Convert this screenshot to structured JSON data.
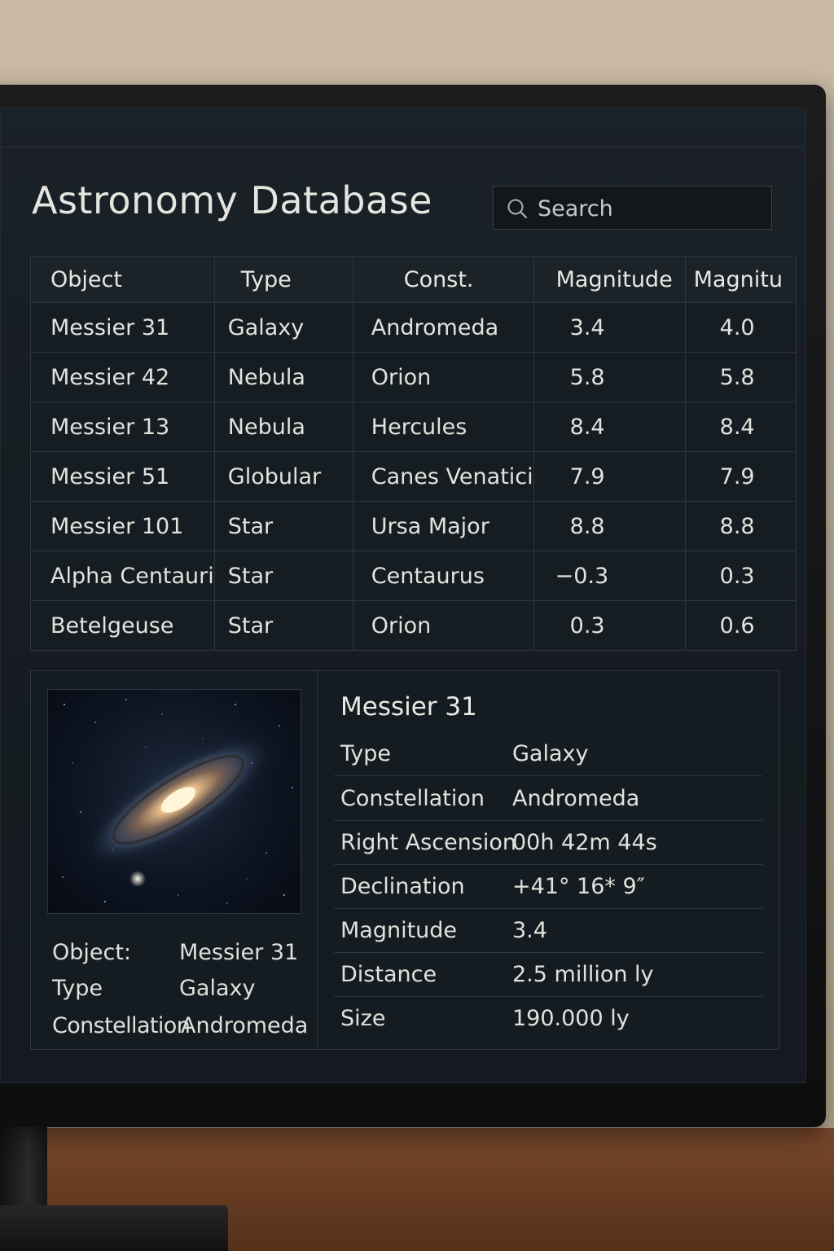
{
  "app": {
    "title": "Astronomy Database"
  },
  "search": {
    "placeholder": "Search"
  },
  "table": {
    "columns": [
      "Object",
      "Type",
      "Const.",
      "Magnitude",
      "Magnitu"
    ],
    "rows": [
      [
        "Messier 31",
        "Galaxy",
        "Andromeda",
        "3.4",
        "4.0"
      ],
      [
        "Messier 42",
        "Nebula",
        "Orion",
        "5.8",
        "5.8"
      ],
      [
        "Messier 13",
        "Nebula",
        "Hercules",
        "8.4",
        "8.4"
      ],
      [
        "Messier 51",
        "Globular",
        "Canes Venatici",
        "7.9",
        "7.9"
      ],
      [
        "Messier 101",
        "Star",
        "Ursa Major",
        "8.8",
        "8.8"
      ],
      [
        "Alpha Centauri",
        "Star",
        "Centaurus",
        "−0.3",
        "0.3"
      ],
      [
        "Betelgeuse",
        "Star",
        "Orion",
        "0.3",
        "0.6"
      ]
    ]
  },
  "preview": {
    "image_icon": "galaxy-image",
    "rows": [
      {
        "label": "Object:",
        "value": "Messier 31"
      },
      {
        "label": "Type",
        "value": "Galaxy"
      },
      {
        "label": "Constellation",
        "value": "Andromeda"
      }
    ]
  },
  "detail": {
    "title": "Messier 31",
    "properties": [
      {
        "label": "Type",
        "value": "Galaxy"
      },
      {
        "label": "Constellation",
        "value": "Andromeda"
      },
      {
        "label": "Right Ascension",
        "value": "00h 42m 44s"
      },
      {
        "label": "Declination",
        "value": "+41° 16* 9″"
      },
      {
        "label": "Magnitude",
        "value": "3.4"
      },
      {
        "label": "Distance",
        "value": "2.5 million ly"
      },
      {
        "label": "Size",
        "value": "190.000 ly"
      }
    ]
  },
  "colors": {
    "screen_bg": "#161d22",
    "text": "#e3e2dc",
    "grid_line": "#2e373e",
    "wall": "#c9b9a6",
    "desk": "#6a3e24"
  }
}
